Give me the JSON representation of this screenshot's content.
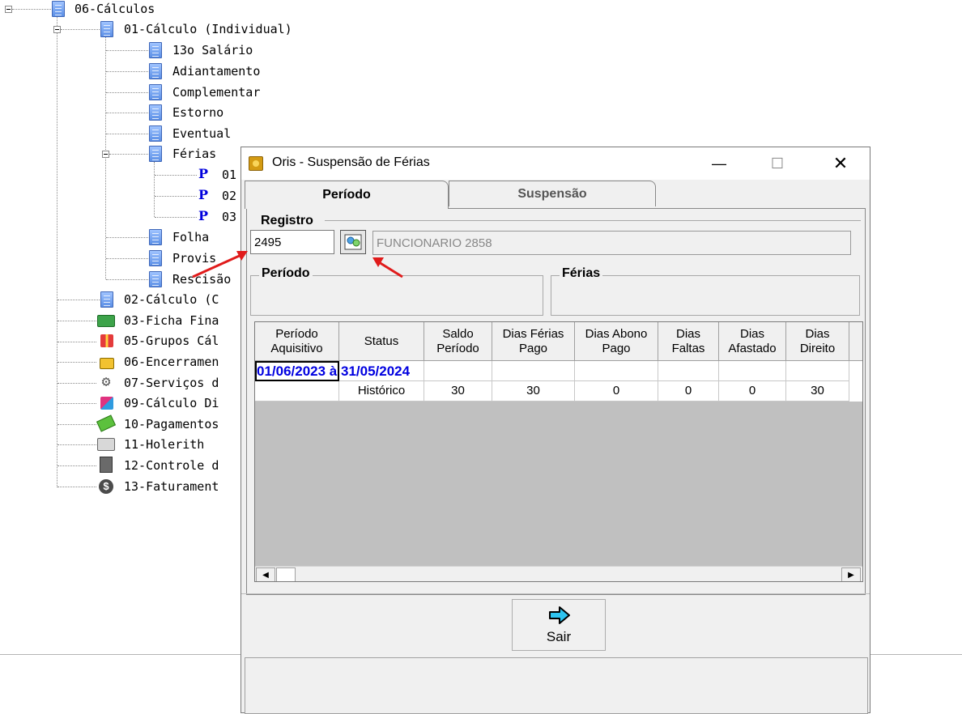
{
  "tree": {
    "root": {
      "label": "06-Cálculos"
    },
    "calc_individual": {
      "label": "01-Cálculo (Individual)"
    },
    "children": [
      {
        "label": "13o Salário"
      },
      {
        "label": "Adiantamento"
      },
      {
        "label": "Complementar"
      },
      {
        "label": "Estorno"
      },
      {
        "label": "Eventual"
      },
      {
        "label": "Férias"
      }
    ],
    "ferias_children": [
      {
        "icon": "P",
        "label": "01"
      },
      {
        "icon": "P",
        "label": "02"
      },
      {
        "icon": "P",
        "label": "03"
      }
    ],
    "more_children": [
      {
        "label": "Folha"
      },
      {
        "label": "Provis"
      },
      {
        "label": "Rescisão"
      }
    ],
    "top_items": [
      {
        "label": "02-Cálculo (C",
        "icon": "document-stack-icon"
      },
      {
        "label": "03-Ficha Fina",
        "icon": "money-icon"
      },
      {
        "label": "05-Grupos Cál",
        "icon": "gift-icon"
      },
      {
        "label": "06-Encerramen",
        "icon": "lock-icon"
      },
      {
        "label": "07-Serviços d",
        "icon": "gears-icon"
      },
      {
        "label": "09-Cálculo Di",
        "icon": "cubes-icon"
      },
      {
        "label": "10-Pagamentos",
        "icon": "payment-icon"
      },
      {
        "label": "11-Holerith",
        "icon": "printer-icon"
      },
      {
        "label": "12-Controle d",
        "icon": "cabinet-icon"
      },
      {
        "label": "13-Faturament",
        "icon": "dollar-coin-icon"
      }
    ]
  },
  "dialog": {
    "title": "Oris - Suspensão de Férias",
    "controls": {
      "minimize": "—",
      "maximize": "☐",
      "close": "✕"
    },
    "tabs": [
      {
        "label": "Período",
        "active": true
      },
      {
        "label": "Suspensão",
        "active": false
      }
    ],
    "registro": {
      "label": "Registro",
      "value": "2495",
      "name": "FUNCIONARIO 2858"
    },
    "periodo_group": {
      "label": "Período"
    },
    "ferias_group": {
      "label": "Férias"
    },
    "grid": {
      "columns": [
        {
          "label": "Período Aquisitivo"
        },
        {
          "label": "Status"
        },
        {
          "label": "Saldo Período"
        },
        {
          "label": "Dias Férias Pago"
        },
        {
          "label": "Dias Abono Pago"
        },
        {
          "label": "Dias Faltas"
        },
        {
          "label": "Dias Afastado"
        },
        {
          "label": "Dias Direito"
        }
      ],
      "period_row": "01/06/2023 à 31/05/2024",
      "rows": [
        [
          "",
          "Histórico",
          "30",
          "30",
          "0",
          "0",
          "0",
          "30"
        ]
      ]
    },
    "sair_button": {
      "label": "Sair"
    }
  },
  "colors": {
    "accent_blue": "#0000e0",
    "annotation_red": "#e01b1b"
  }
}
